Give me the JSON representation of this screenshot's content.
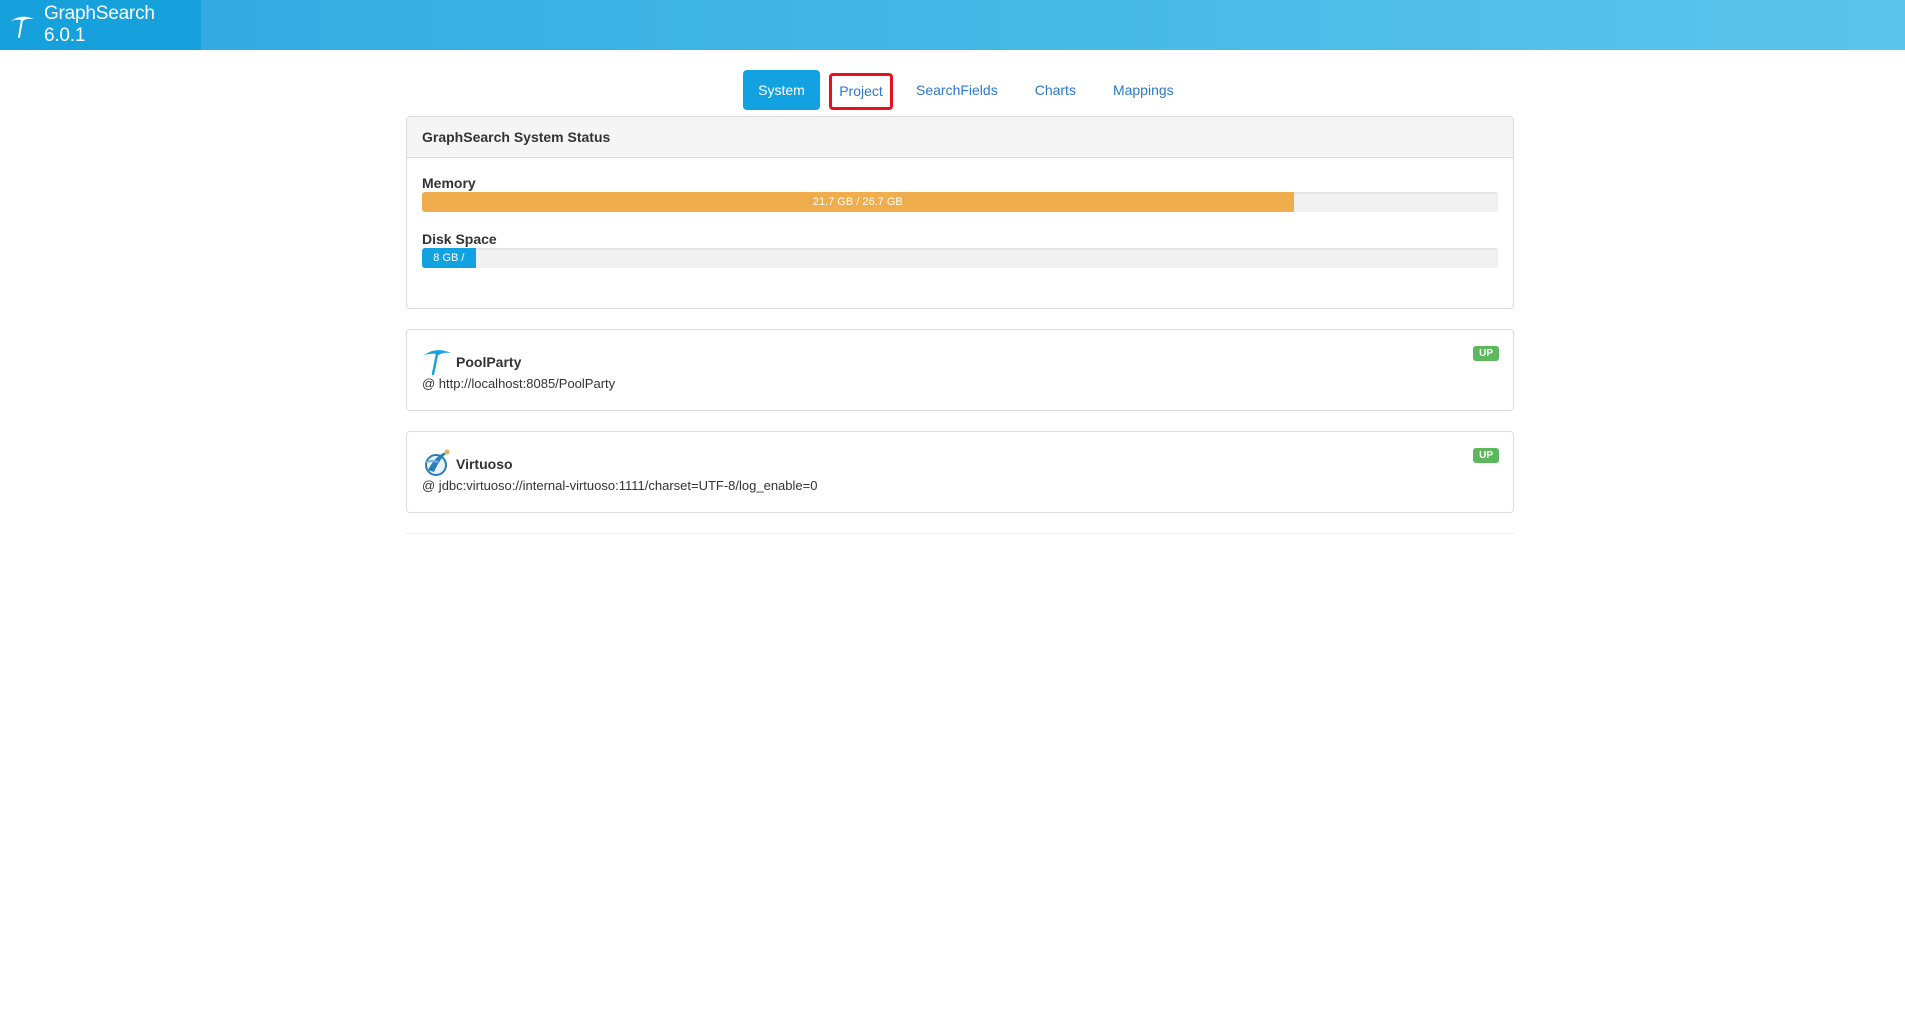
{
  "app": {
    "title": "GraphSearch 6.0.1",
    "logo_icon": "umbrella-icon",
    "brand_color": "#16a0dc"
  },
  "tabs": [
    {
      "label": "System",
      "active": true
    },
    {
      "label": "Project",
      "active": false,
      "highlighted": true
    },
    {
      "label": "SearchFields",
      "active": false
    },
    {
      "label": "Charts",
      "active": false
    },
    {
      "label": "Mappings",
      "active": false
    }
  ],
  "status_panel": {
    "title": "GraphSearch System Status",
    "memory": {
      "label": "Memory",
      "text": "21.7 GB / 26.7 GB",
      "fraction": 0.81,
      "color": "#f0ad4e"
    },
    "disk": {
      "label": "Disk Space",
      "text": "8 GB /",
      "fraction": 0.05,
      "color": "#12a2e2"
    }
  },
  "services": [
    {
      "name": "PoolParty",
      "icon": "umbrella-icon",
      "url": "@ http://localhost:8085/PoolParty",
      "status": "UP"
    },
    {
      "name": "Virtuoso",
      "icon": "virtuoso-icon",
      "url": "@ jdbc:virtuoso://internal-virtuoso:1111/charset=UTF-8/log_enable=0",
      "status": "UP"
    }
  ]
}
